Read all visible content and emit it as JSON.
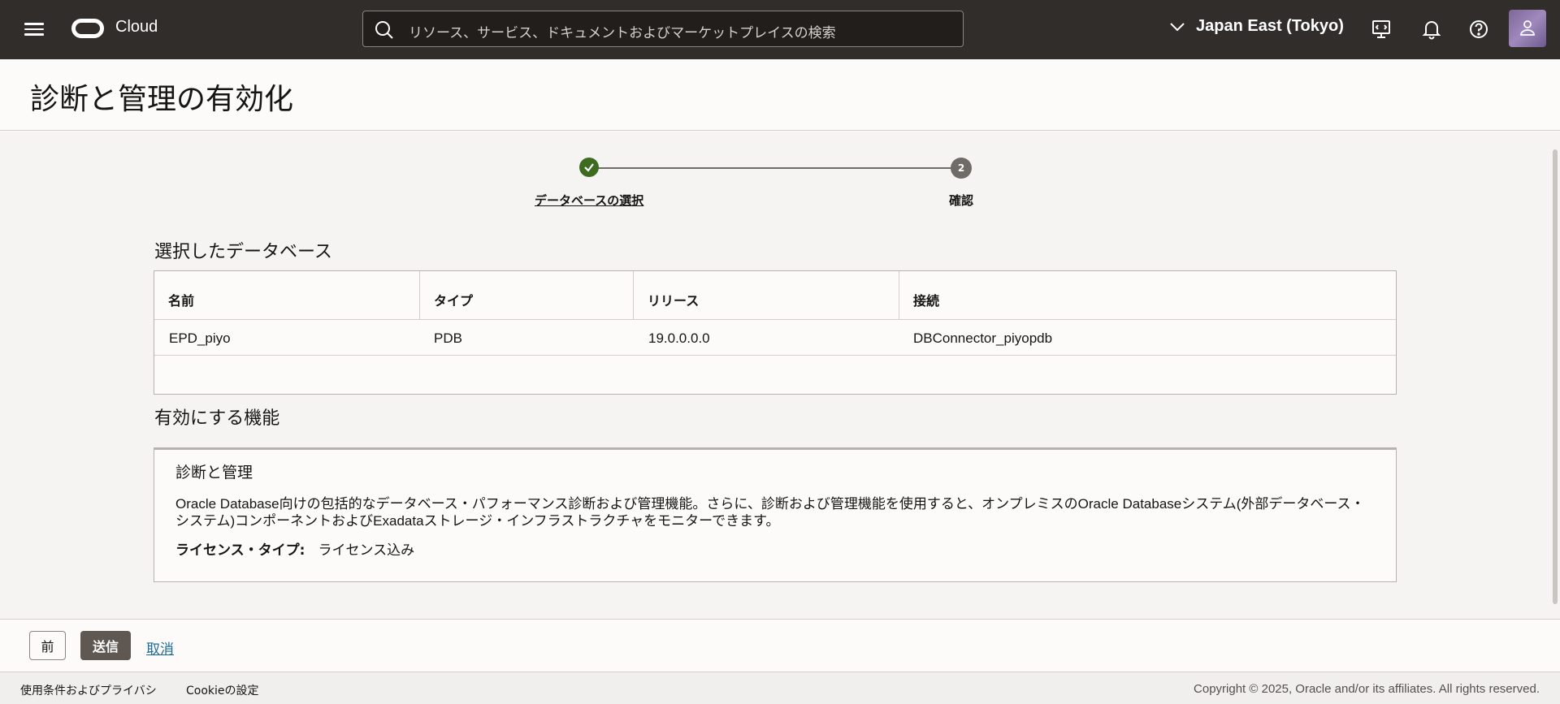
{
  "header": {
    "brand": "Cloud",
    "search_placeholder": "リソース、サービス、ドキュメントおよびマーケットプレイスの検索",
    "region": "Japan East (Tokyo)"
  },
  "page": {
    "title": "診断と管理の有効化"
  },
  "stepper": {
    "steps": [
      {
        "label": "データベースの選択",
        "status": "completed"
      },
      {
        "label": "確認",
        "number": "2",
        "status": "current"
      }
    ]
  },
  "selected_databases": {
    "title": "選択したデータベース",
    "columns": [
      "名前",
      "タイプ",
      "リリース",
      "接続"
    ],
    "rows": [
      [
        "EPD_piyo",
        "PDB",
        "19.0.0.0.0",
        "DBConnector_piyopdb"
      ]
    ]
  },
  "features": {
    "title": "有効にする機能",
    "card": {
      "title": "診断と管理",
      "description": "Oracle Database向けの包括的なデータベース・パフォーマンス診断および管理機能。さらに、診断および管理機能を使用すると、オンプレミスのOracle Databaseシステム(外部データベース・システム)コンポーネントおよびExadataストレージ・インフラストラクチャをモニターできます。",
      "license_label": "ライセンス・タイプ:",
      "license_value": "ライセンス込み"
    }
  },
  "actions": {
    "prev": "前",
    "submit": "送信",
    "cancel": "取消"
  },
  "footer": {
    "terms": "使用条件およびプライバシ",
    "cookies": "Cookieの設定",
    "copyright": "Copyright © 2025, Oracle and/or its affiliates. All rights reserved."
  },
  "colors": {
    "topbar": "#312d2a",
    "step_complete": "#3d6b1f",
    "step_current": "#6f6b67",
    "submit_button": "#5e5752",
    "link": "#1e6b99"
  },
  "icons": [
    "hamburger-menu-icon",
    "oracle-logo-icon",
    "search-icon",
    "chevron-down-icon",
    "cloud-shell-icon",
    "bell-icon",
    "help-icon",
    "avatar-icon",
    "checkmark-icon"
  ]
}
